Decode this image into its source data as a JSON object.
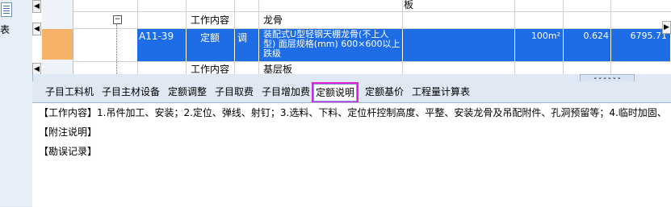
{
  "left_strip": {
    "label": "表"
  },
  "grid": {
    "top_row": {
      "name": "板"
    },
    "rows": [
      {
        "type": "工作内容",
        "name": "龙骨"
      },
      {
        "code": "A11-39",
        "type": "定额",
        "flag": "调",
        "name": "装配式U型轻钢天棚龙骨(不上人型) 面层规格(mm) 600×600以上 跌级",
        "unit": "100m²",
        "qty": "0.624",
        "amount": "6795.71"
      },
      {
        "type": "工作内容",
        "name": "基层板"
      }
    ],
    "toggle": "−"
  },
  "tabs": [
    "子目工料机",
    "子目主材设备",
    "定额调整",
    "子目取费",
    "子目增加费",
    "定额说明",
    "定额基价",
    "工程量计算表"
  ],
  "active_tab": "定额说明",
  "active_tab_color": "#e020e0",
  "selection_color": "#1e6ce6",
  "content": {
    "work_content": "【工作内容】1.吊件加工、安装；2.定位、弹线、射钉；3.选料、下料、定位杆控制高度、平整、安装龙骨及吊配附件、孔洞预留等；4.临时加固、",
    "notes": "【附注说明】",
    "errata": "【勘误记录】"
  }
}
